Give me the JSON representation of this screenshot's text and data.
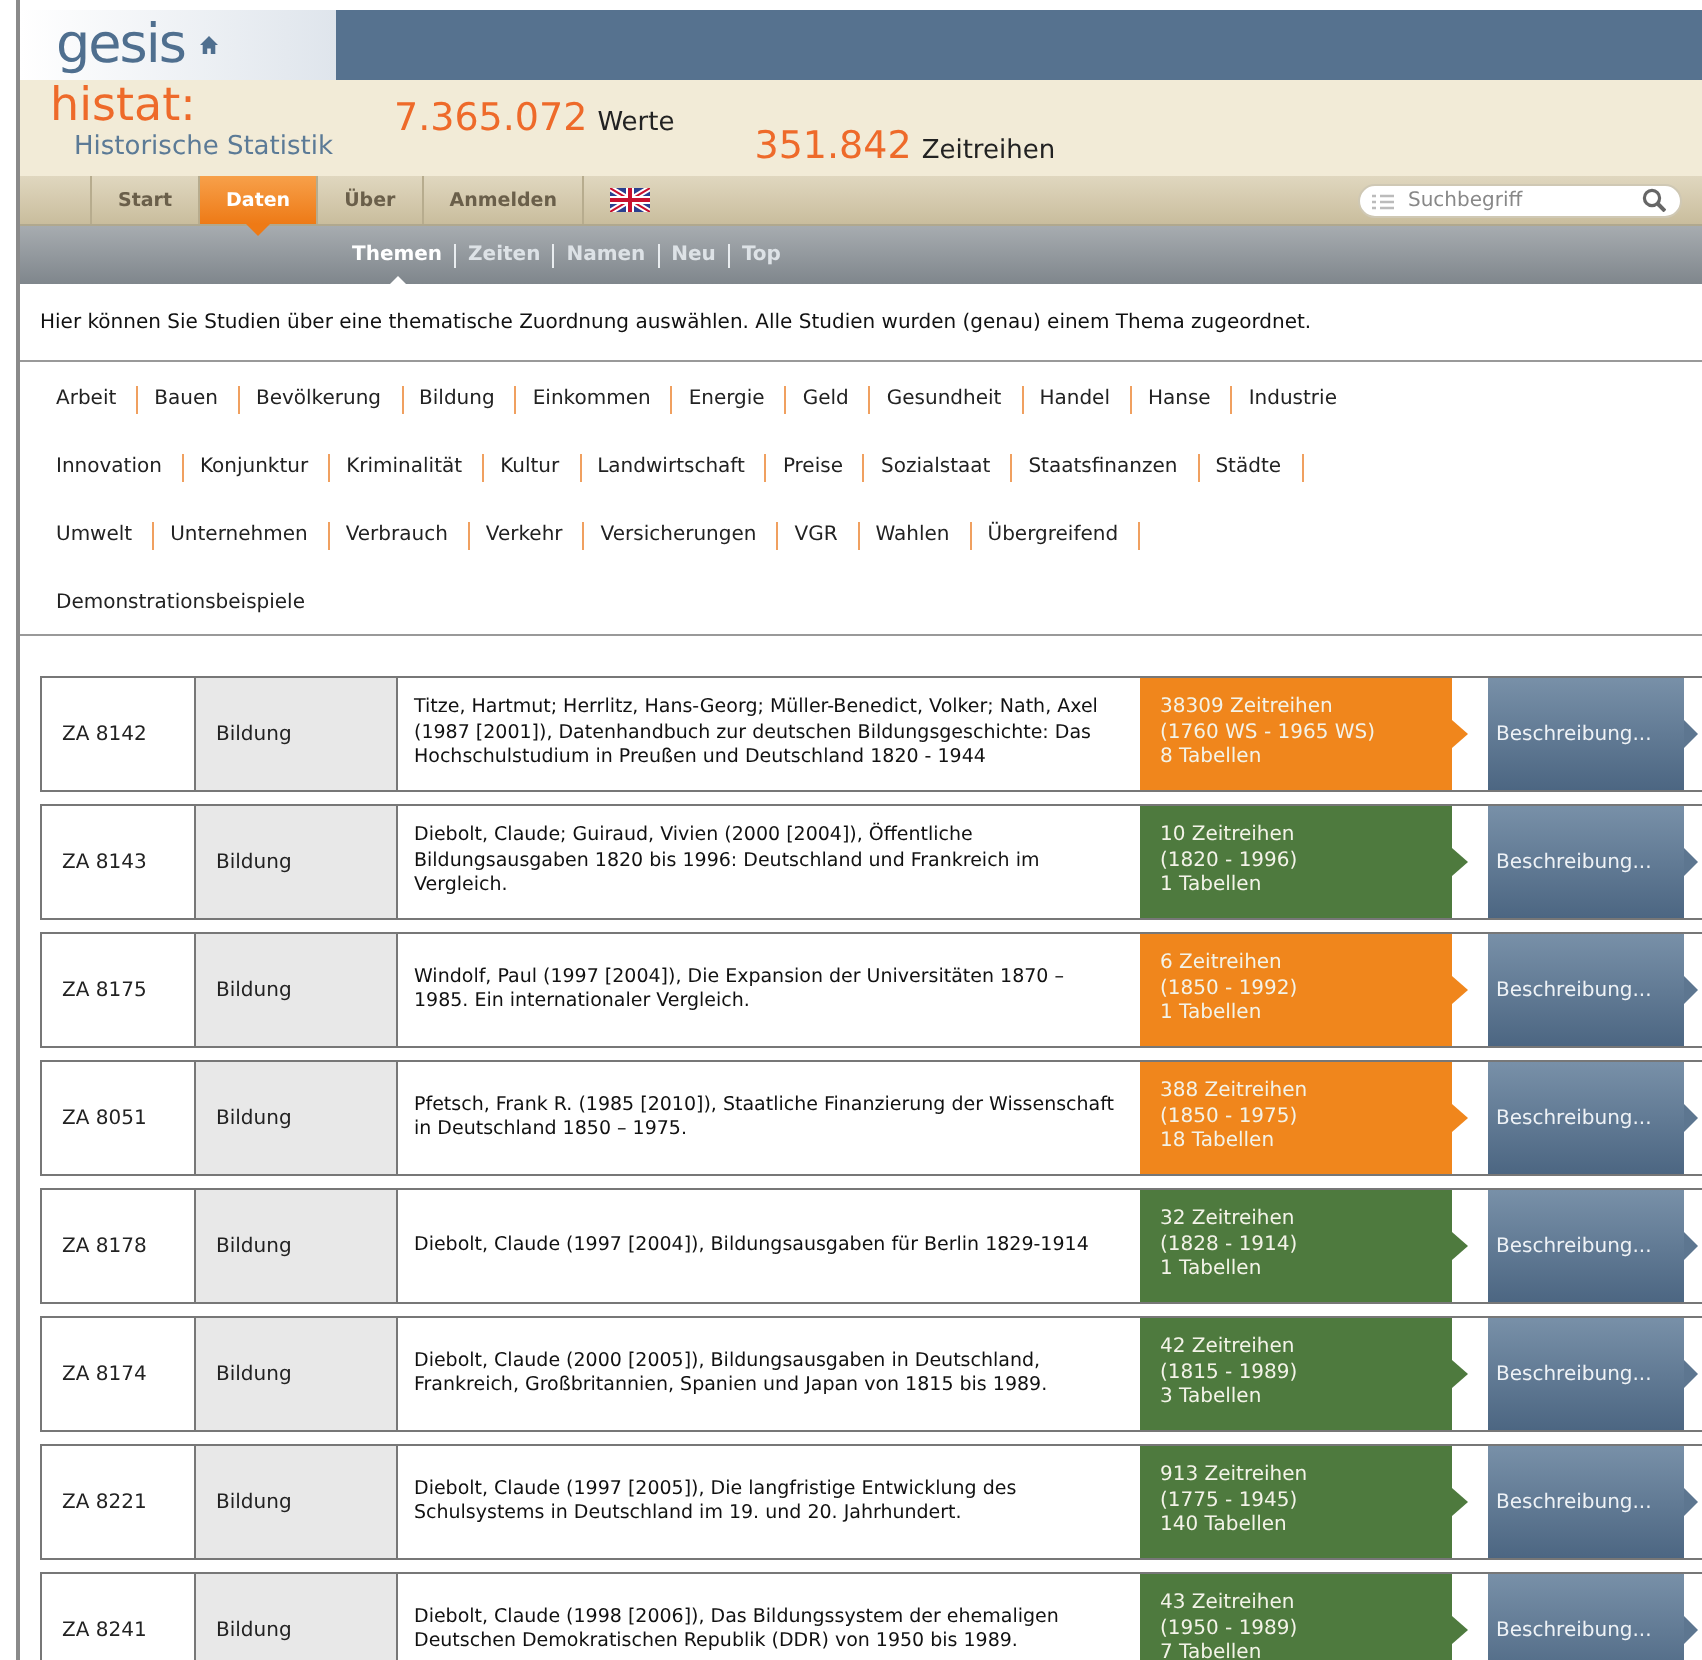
{
  "header": {
    "logo": "gesis",
    "title": "histat:",
    "subtitle": "Historische Statistik",
    "stats": [
      {
        "value": "7.365.072",
        "label": "Werte"
      },
      {
        "value": "351.842",
        "label": "Zeitreihen"
      }
    ]
  },
  "nav": {
    "tabs": [
      {
        "kind": "text",
        "label": "Start",
        "selected": false
      },
      {
        "kind": "text",
        "label": "Daten",
        "selected": true
      },
      {
        "kind": "text",
        "label": "Über",
        "selected": false
      },
      {
        "kind": "text",
        "label": "Anmelden",
        "selected": false
      },
      {
        "kind": "flag",
        "selected": false
      }
    ],
    "search": {
      "placeholder": "Suchbegriff"
    }
  },
  "subnav": [
    {
      "label": "Themen",
      "selected": true
    },
    {
      "label": "Zeiten",
      "selected": false
    },
    {
      "label": "Namen",
      "selected": false
    },
    {
      "label": "Neu",
      "selected": false
    },
    {
      "label": "Top",
      "selected": false
    }
  ],
  "intro": "Hier können Sie Studien über eine thematische Zuordnung auswählen. Alle Studien wurden (genau) einem Thema zugeordnet.",
  "topics": [
    "Arbeit",
    "Bauen",
    "Bevölkerung",
    "Bildung",
    "Einkommen",
    "Energie",
    "Geld",
    "Gesundheit",
    "Handel",
    "Hanse",
    "Industrie",
    "Innovation",
    "Konjunktur",
    "Kriminalität",
    "Kultur",
    "Landwirtschaft",
    "Preise",
    "Sozialstaat",
    "Staatsfinanzen",
    "Städte",
    "Umwelt",
    "Unternehmen",
    "Verbrauch",
    "Verkehr",
    "Versicherungen",
    "VGR",
    "Wahlen",
    "Übergreifend",
    "Demonstrationsbeispiele"
  ],
  "studies": [
    {
      "id": "ZA 8142",
      "topic": "Bildung",
      "citation": "Titze, Hartmut; Herrlitz, Hans-Georg; Müller-Benedict, Volker; Nath, Axel (1987 [2001]), Datenhandbuch zur deutschen Bildungsgeschichte: Das Hochschulstudium in Preußen und Deutschland 1820 - 1944",
      "series": "38309 Zeitreihen",
      "range": "(1760 WS - 1965 WS)",
      "tables": "8 Tabellen",
      "color": "#f0861c",
      "button": "Beschreibung..."
    },
    {
      "id": "ZA 8143",
      "topic": "Bildung",
      "citation": "Diebolt, Claude; Guiraud, Vivien (2000 [2004]), Öffentliche Bildungsausgaben 1820 bis 1996: Deutschland und Frankreich im Vergleich.",
      "series": "10 Zeitreihen",
      "range": "(1820 - 1996)",
      "tables": "1 Tabellen",
      "color": "#4e7a3e",
      "button": "Beschreibung..."
    },
    {
      "id": "ZA 8175",
      "topic": "Bildung",
      "citation": "Windolf, Paul (1997 [2004]), Die Expansion der Universitäten 1870 – 1985. Ein internationaler Vergleich.",
      "series": "6 Zeitreihen",
      "range": "(1850 - 1992)",
      "tables": "1 Tabellen",
      "color": "#f0861c",
      "button": "Beschreibung..."
    },
    {
      "id": "ZA 8051",
      "topic": "Bildung",
      "citation": "Pfetsch, Frank R. (1985 [2010]), Staatliche Finanzierung der Wissenschaft in Deutschland 1850 – 1975.",
      "series": "388 Zeitreihen",
      "range": "(1850 - 1975)",
      "tables": "18 Tabellen",
      "color": "#f0861c",
      "button": "Beschreibung..."
    },
    {
      "id": "ZA 8178",
      "topic": "Bildung",
      "citation": "Diebolt, Claude (1997 [2004]), Bildungsausgaben für Berlin 1829-1914",
      "series": "32 Zeitreihen",
      "range": "(1828 - 1914)",
      "tables": "1 Tabellen",
      "color": "#4e7a3e",
      "button": "Beschreibung..."
    },
    {
      "id": "ZA 8174",
      "topic": "Bildung",
      "citation": "Diebolt, Claude (2000 [2005]), Bildungsausgaben in Deutschland, Frankreich, Großbritannien, Spanien und Japan von 1815 bis 1989.",
      "series": "42 Zeitreihen",
      "range": "(1815 - 1989)",
      "tables": "3 Tabellen",
      "color": "#4e7a3e",
      "button": "Beschreibung..."
    },
    {
      "id": "ZA 8221",
      "topic": "Bildung",
      "citation": "Diebolt, Claude (1997 [2005]), Die langfristige Entwicklung des Schulsystems in Deutschland im 19. und 20. Jahrhundert.",
      "series": "913 Zeitreihen",
      "range": "(1775 - 1945)",
      "tables": "140 Tabellen",
      "color": "#4e7a3e",
      "button": "Beschreibung..."
    },
    {
      "id": "ZA 8241",
      "topic": "Bildung",
      "citation": "Diebolt, Claude (1998 [2006]), Das Bildungssystem der ehemaligen Deutschen Demokratischen Republik (DDR) von 1950 bis 1989.",
      "series": "43 Zeitreihen",
      "range": "(1950 - 1989)",
      "tables": "7 Tabellen",
      "color": "#4e7a3e",
      "button": "Beschreibung..."
    }
  ]
}
